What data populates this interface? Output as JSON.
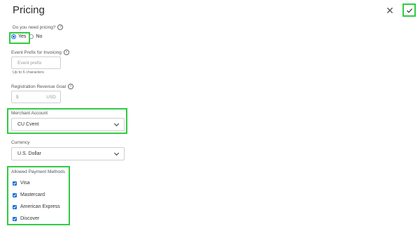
{
  "header": {
    "title": "Pricing",
    "close_icon": "close-icon",
    "save_icon": "check-icon"
  },
  "pricing": {
    "question": "Do you need pricing?",
    "options": [
      {
        "label": "Yes",
        "selected": true
      },
      {
        "label": "No",
        "selected": false
      }
    ]
  },
  "event_prefix": {
    "label": "Event Prefix for Invoicing",
    "placeholder": "Event prefix",
    "hint": "Up to 6 characters"
  },
  "revenue_goal": {
    "label": "Registration Revenue Goal",
    "prefix": "$",
    "suffix": "USD"
  },
  "merchant": {
    "label": "Merchant Account",
    "value": "CU Cvent"
  },
  "currency": {
    "label": "Currency",
    "value": "U.S. Dollar"
  },
  "payment_methods": {
    "label": "Allowed Payment Methods",
    "items": [
      {
        "label": "Visa",
        "checked": true
      },
      {
        "label": "Mastercard",
        "checked": true
      },
      {
        "label": "American Express",
        "checked": true
      },
      {
        "label": "Discover",
        "checked": true
      }
    ]
  },
  "colors": {
    "accent": "#1a6fd6",
    "highlight": "#2ecc40"
  }
}
